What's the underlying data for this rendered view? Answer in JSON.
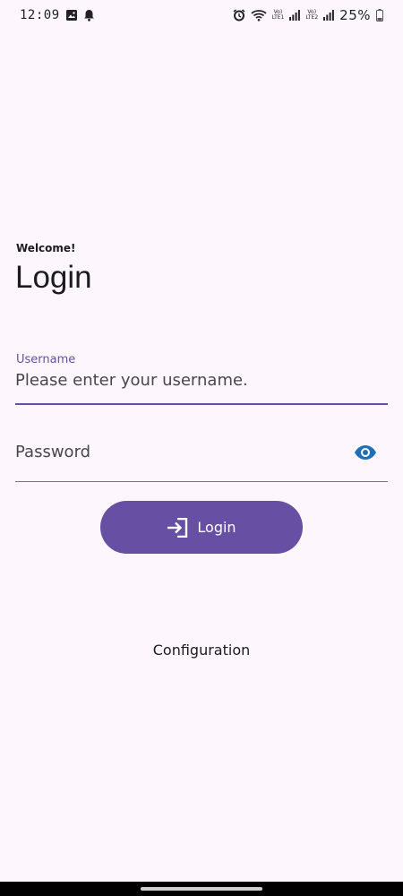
{
  "status_bar": {
    "time": "12:09",
    "battery": "25%",
    "sim1_label_top": "Vo)",
    "sim1_label_bottom": "LTE1",
    "sim2_label_top": "Vo)",
    "sim2_label_bottom": "LTE2",
    "icons": [
      "image-icon",
      "notification-bell-icon",
      "alarm-icon",
      "wifi-icon",
      "signal-icon",
      "battery-icon"
    ]
  },
  "login": {
    "welcome": "Welcome!",
    "title": "Login",
    "username_label": "Username",
    "username_placeholder": "Please enter your username.",
    "username_value": "",
    "password_placeholder": "Password",
    "password_value": "",
    "password_visibility_icon": "eye-icon",
    "login_button_label": "Login",
    "login_button_icon": "login-icon",
    "configuration_link": "Configuration"
  },
  "colors": {
    "primary": "#6750a4",
    "background": "#fdf7fd",
    "eye_icon": "#1f6fb8",
    "text": "#1c1b1f"
  }
}
